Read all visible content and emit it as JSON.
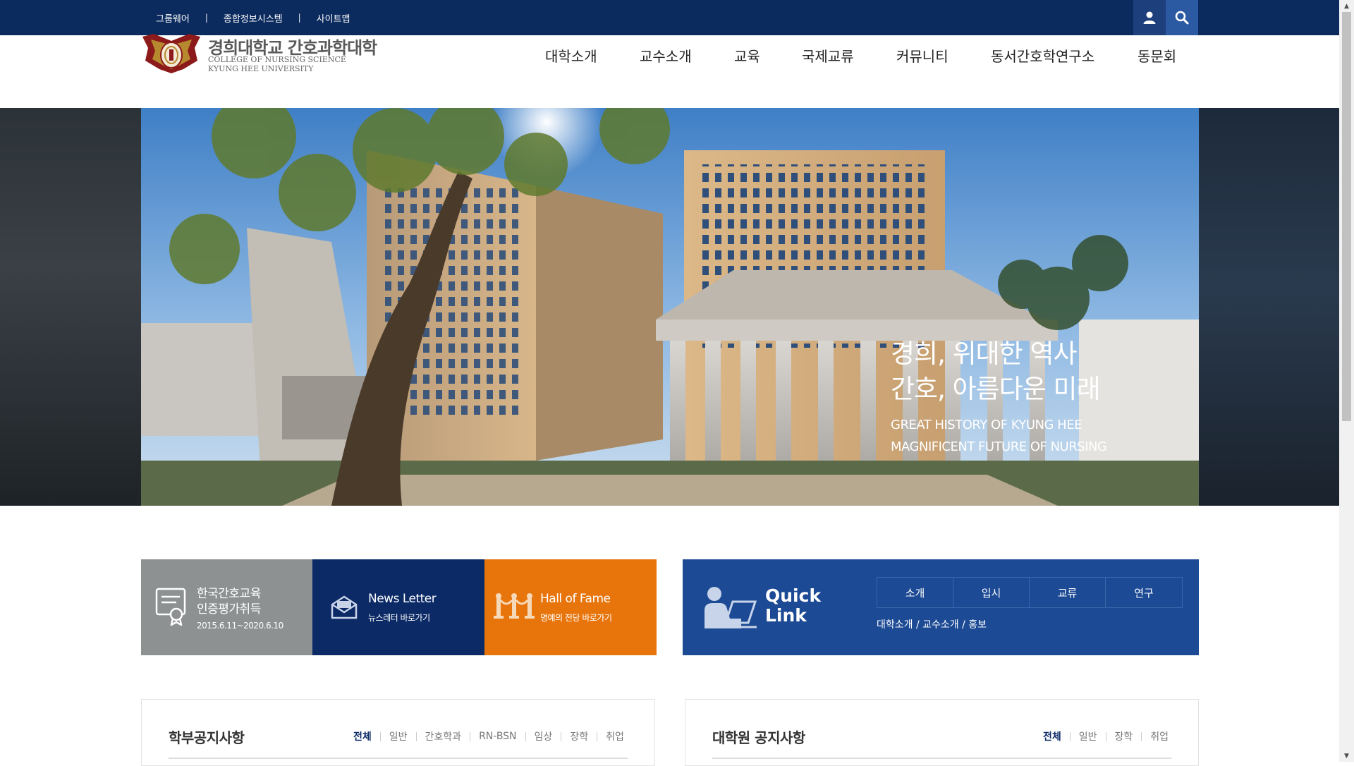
{
  "utility_bar": {
    "links": [
      "그룹웨어",
      "종합정보시스템",
      "사이트맵"
    ],
    "separator": "|"
  },
  "icons": {
    "user": "user-icon",
    "search": "search-icon"
  },
  "logo": {
    "title": "경희대학교 간호과학대학",
    "subtitle_line1": "COLLEGE OF NURSING SCIENCE",
    "subtitle_line2": "KYUNG HEE UNIVERSITY"
  },
  "nav": {
    "items": [
      "대학소개",
      "교수소개",
      "교육",
      "국제교류",
      "커뮤니티",
      "동서간호학연구소",
      "동문회"
    ]
  },
  "hero": {
    "ko_line1": "경희, 위대한 역사",
    "ko_line2": "간호, 아름다운 미래",
    "en_line1": "GREAT HISTORY OF KYUNG HEE",
    "en_line2": "MAGNIFICENT FUTURE OF NURSING"
  },
  "cards": {
    "cert": {
      "title_line1": "한국간호교육",
      "title_line2": "인증평가취득",
      "dates": "2015.6.11~2020.6.10",
      "color": "#8e9191"
    },
    "news": {
      "title": "News Letter",
      "sub": "뉴스레터 바로가기",
      "color": "#0b2a66"
    },
    "fame": {
      "title": "Hall of Fame",
      "sub": "명예의 전당 바로가기",
      "color": "#e8750c"
    }
  },
  "quick_link": {
    "title_line1": "Quick",
    "title_line2": "Link",
    "tabs": [
      "소개",
      "입시",
      "교류",
      "연구"
    ],
    "links": "대학소개 / 교수소개 / 홍보",
    "color": "#1c4a94"
  },
  "notice_undergrad": {
    "title": "학부공지사항",
    "tabs": [
      "전체",
      "일반",
      "간호학과",
      "RN-BSN",
      "임상",
      "장학",
      "취업"
    ]
  },
  "notice_grad": {
    "title": "대학원 공지사항",
    "tabs": [
      "전체",
      "일반",
      "장학",
      "취업"
    ]
  },
  "colors": {
    "topbar": "#0b2a5e",
    "accent_orange": "#e8750c",
    "navy": "#0b2a66"
  }
}
